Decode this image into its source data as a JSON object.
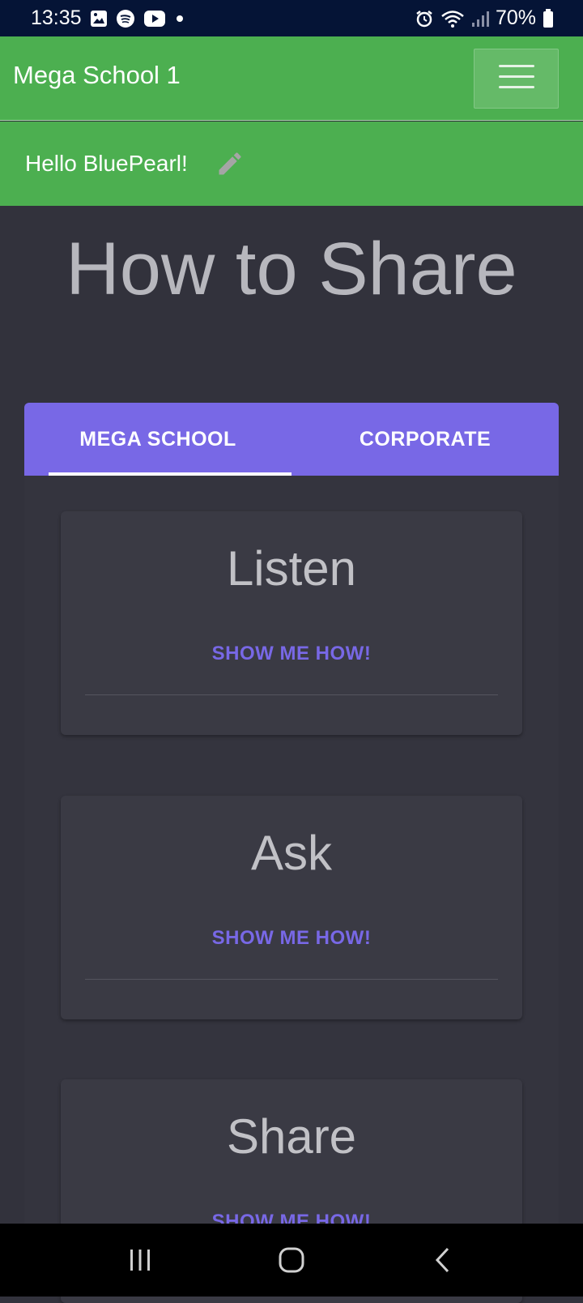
{
  "status_bar": {
    "time": "13:35",
    "battery": "70%",
    "icons": [
      "gallery-icon",
      "spotify-icon",
      "youtube-icon",
      "dot-icon",
      "alarm-icon",
      "wifi-icon",
      "signal-icon",
      "battery-icon"
    ]
  },
  "app_bar": {
    "title": "Mega School 1"
  },
  "greeting": {
    "text": "Hello BluePearl!"
  },
  "page": {
    "title": "How to Share"
  },
  "tabs": [
    {
      "label": "MEGA SCHOOL",
      "active": true
    },
    {
      "label": "CORPORATE",
      "active": false
    }
  ],
  "cards": [
    {
      "title": "Listen",
      "action": "SHOW ME HOW!"
    },
    {
      "title": "Ask",
      "action": "SHOW ME HOW!"
    },
    {
      "title": "Share",
      "action": "SHOW ME HOW!"
    }
  ],
  "colors": {
    "primary_green": "#4caf50",
    "accent_purple": "#7868e6",
    "background": "#32323c"
  }
}
